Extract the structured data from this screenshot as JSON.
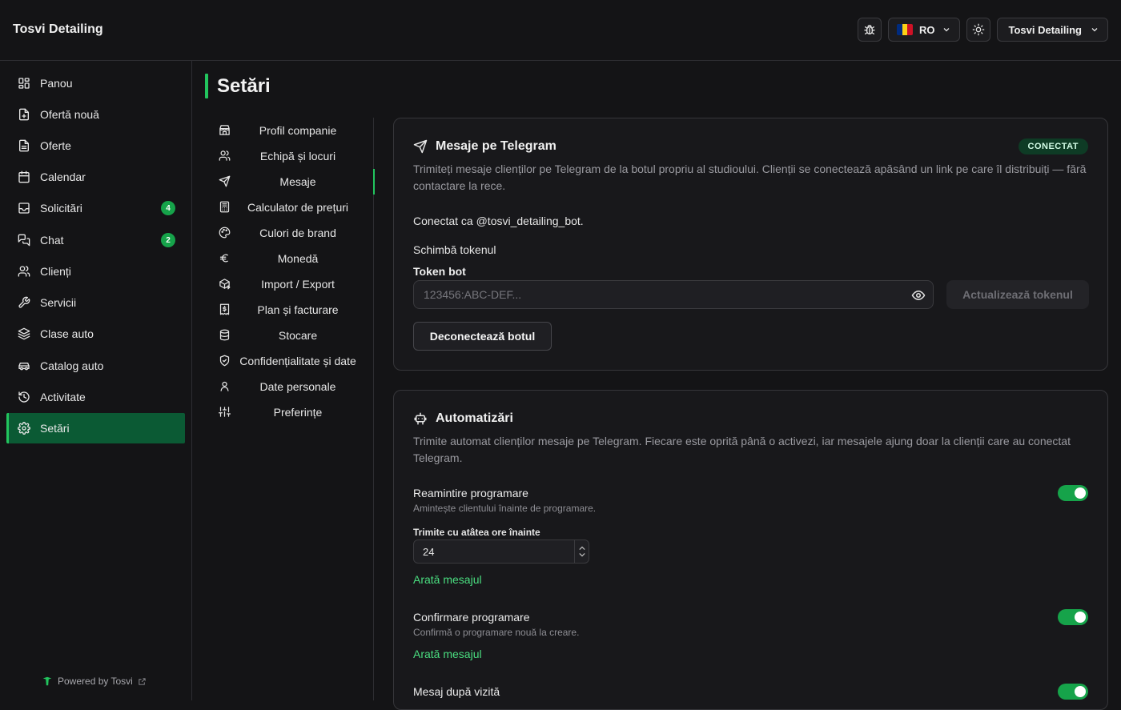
{
  "app": {
    "brand": "Tosvi Detailing"
  },
  "header": {
    "language": "RO",
    "account": "Tosvi Detailing",
    "flag_colors": [
      "#002b7f",
      "#fcd116",
      "#ce1126"
    ]
  },
  "sidebar": {
    "items": [
      {
        "label": "Panou",
        "icon": "dashboard-icon"
      },
      {
        "label": "Ofertă nouă",
        "icon": "file-plus-icon"
      },
      {
        "label": "Oferte",
        "icon": "file-text-icon"
      },
      {
        "label": "Calendar",
        "icon": "calendar-icon"
      },
      {
        "label": "Solicitări",
        "icon": "inbox-icon",
        "badge": "4"
      },
      {
        "label": "Chat",
        "icon": "chat-icon",
        "badge": "2"
      },
      {
        "label": "Clienți",
        "icon": "users-icon"
      },
      {
        "label": "Servicii",
        "icon": "wrench-icon"
      },
      {
        "label": "Clase auto",
        "icon": "layers-icon"
      },
      {
        "label": "Catalog auto",
        "icon": "car-icon"
      },
      {
        "label": "Activitate",
        "icon": "history-icon"
      },
      {
        "label": "Setări",
        "icon": "gear-icon",
        "active": true
      }
    ],
    "powered_by": "Powered by Tosvi"
  },
  "page": {
    "title": "Setări"
  },
  "settings_nav": {
    "items": [
      {
        "label": "Profil companie",
        "icon": "store-icon"
      },
      {
        "label": "Echipă și locuri",
        "icon": "users-icon"
      },
      {
        "label": "Mesaje",
        "icon": "send-icon",
        "active": true
      },
      {
        "label": "Calculator de prețuri",
        "icon": "calculator-icon"
      },
      {
        "label": "Culori de brand",
        "icon": "palette-icon"
      },
      {
        "label": "Monedă",
        "icon": "euro-icon"
      },
      {
        "label": "Import / Export",
        "icon": "package-icon"
      },
      {
        "label": "Plan și facturare",
        "icon": "receipt-icon"
      },
      {
        "label": "Stocare",
        "icon": "database-icon"
      },
      {
        "label": "Confidențialitate și date",
        "icon": "shield-icon"
      },
      {
        "label": "Date personale",
        "icon": "user-icon"
      },
      {
        "label": "Preferințe",
        "icon": "sliders-icon"
      }
    ]
  },
  "telegram": {
    "title": "Mesaje pe Telegram",
    "status": "CONECTAT",
    "description": "Trimiteți mesaje clienților pe Telegram de la botul propriu al studioului. Clienții se conectează apăsând un link pe care îl distribuiți — fără contactare la rece.",
    "connected_as": "Conectat ca @tosvi_detailing_bot.",
    "change_token": "Schimbă tokenul",
    "token_label": "Token bot",
    "token_placeholder": "123456:ABC-DEF...",
    "update_button": "Actualizează tokenul",
    "disconnect_button": "Deconectează botul"
  },
  "automations": {
    "title": "Automatizări",
    "description": "Trimite automat clienților mesaje pe Telegram. Fiecare este oprită până o activezi, iar mesajele ajung doar la clienții care au conectat Telegram.",
    "reminder": {
      "title": "Reamintire programare",
      "subtitle": "Amintește clientului înainte de programare.",
      "hours_label": "Trimite cu atâtea ore înainte",
      "hours_value": "24",
      "show_message": "Arată mesajul",
      "enabled": true
    },
    "confirmation": {
      "title": "Confirmare programare",
      "subtitle": "Confirmă o programare nouă la creare.",
      "show_message": "Arată mesajul",
      "enabled": true
    },
    "after_visit": {
      "title": "Mesaj după vizită",
      "enabled": true
    }
  }
}
